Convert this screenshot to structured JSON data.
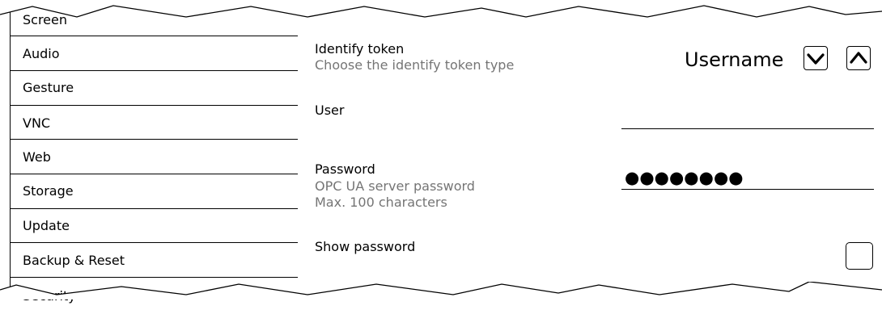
{
  "sidebar": {
    "items": [
      {
        "label": "Screen"
      },
      {
        "label": "Audio"
      },
      {
        "label": "Gesture"
      },
      {
        "label": "VNC"
      },
      {
        "label": "Web"
      },
      {
        "label": "Storage"
      },
      {
        "label": "Update"
      },
      {
        "label": "Backup & Reset"
      },
      {
        "label": "Security"
      }
    ]
  },
  "settings": {
    "identify_token": {
      "title": "Identify token",
      "description": "Choose the identify token type",
      "value": "Username",
      "down_icon": "chevron-down-icon",
      "up_icon": "chevron-up-icon"
    },
    "user": {
      "title": "User",
      "value": ""
    },
    "password": {
      "title": "Password",
      "description_line1": "OPC UA server password",
      "description_line2": "Max. 100 characters",
      "masked_value": "●●●●●●●●"
    },
    "show_password": {
      "title": "Show password",
      "checked": false
    }
  },
  "colors": {
    "text": "#000000",
    "secondary_text": "#757575",
    "background": "#ffffff"
  }
}
